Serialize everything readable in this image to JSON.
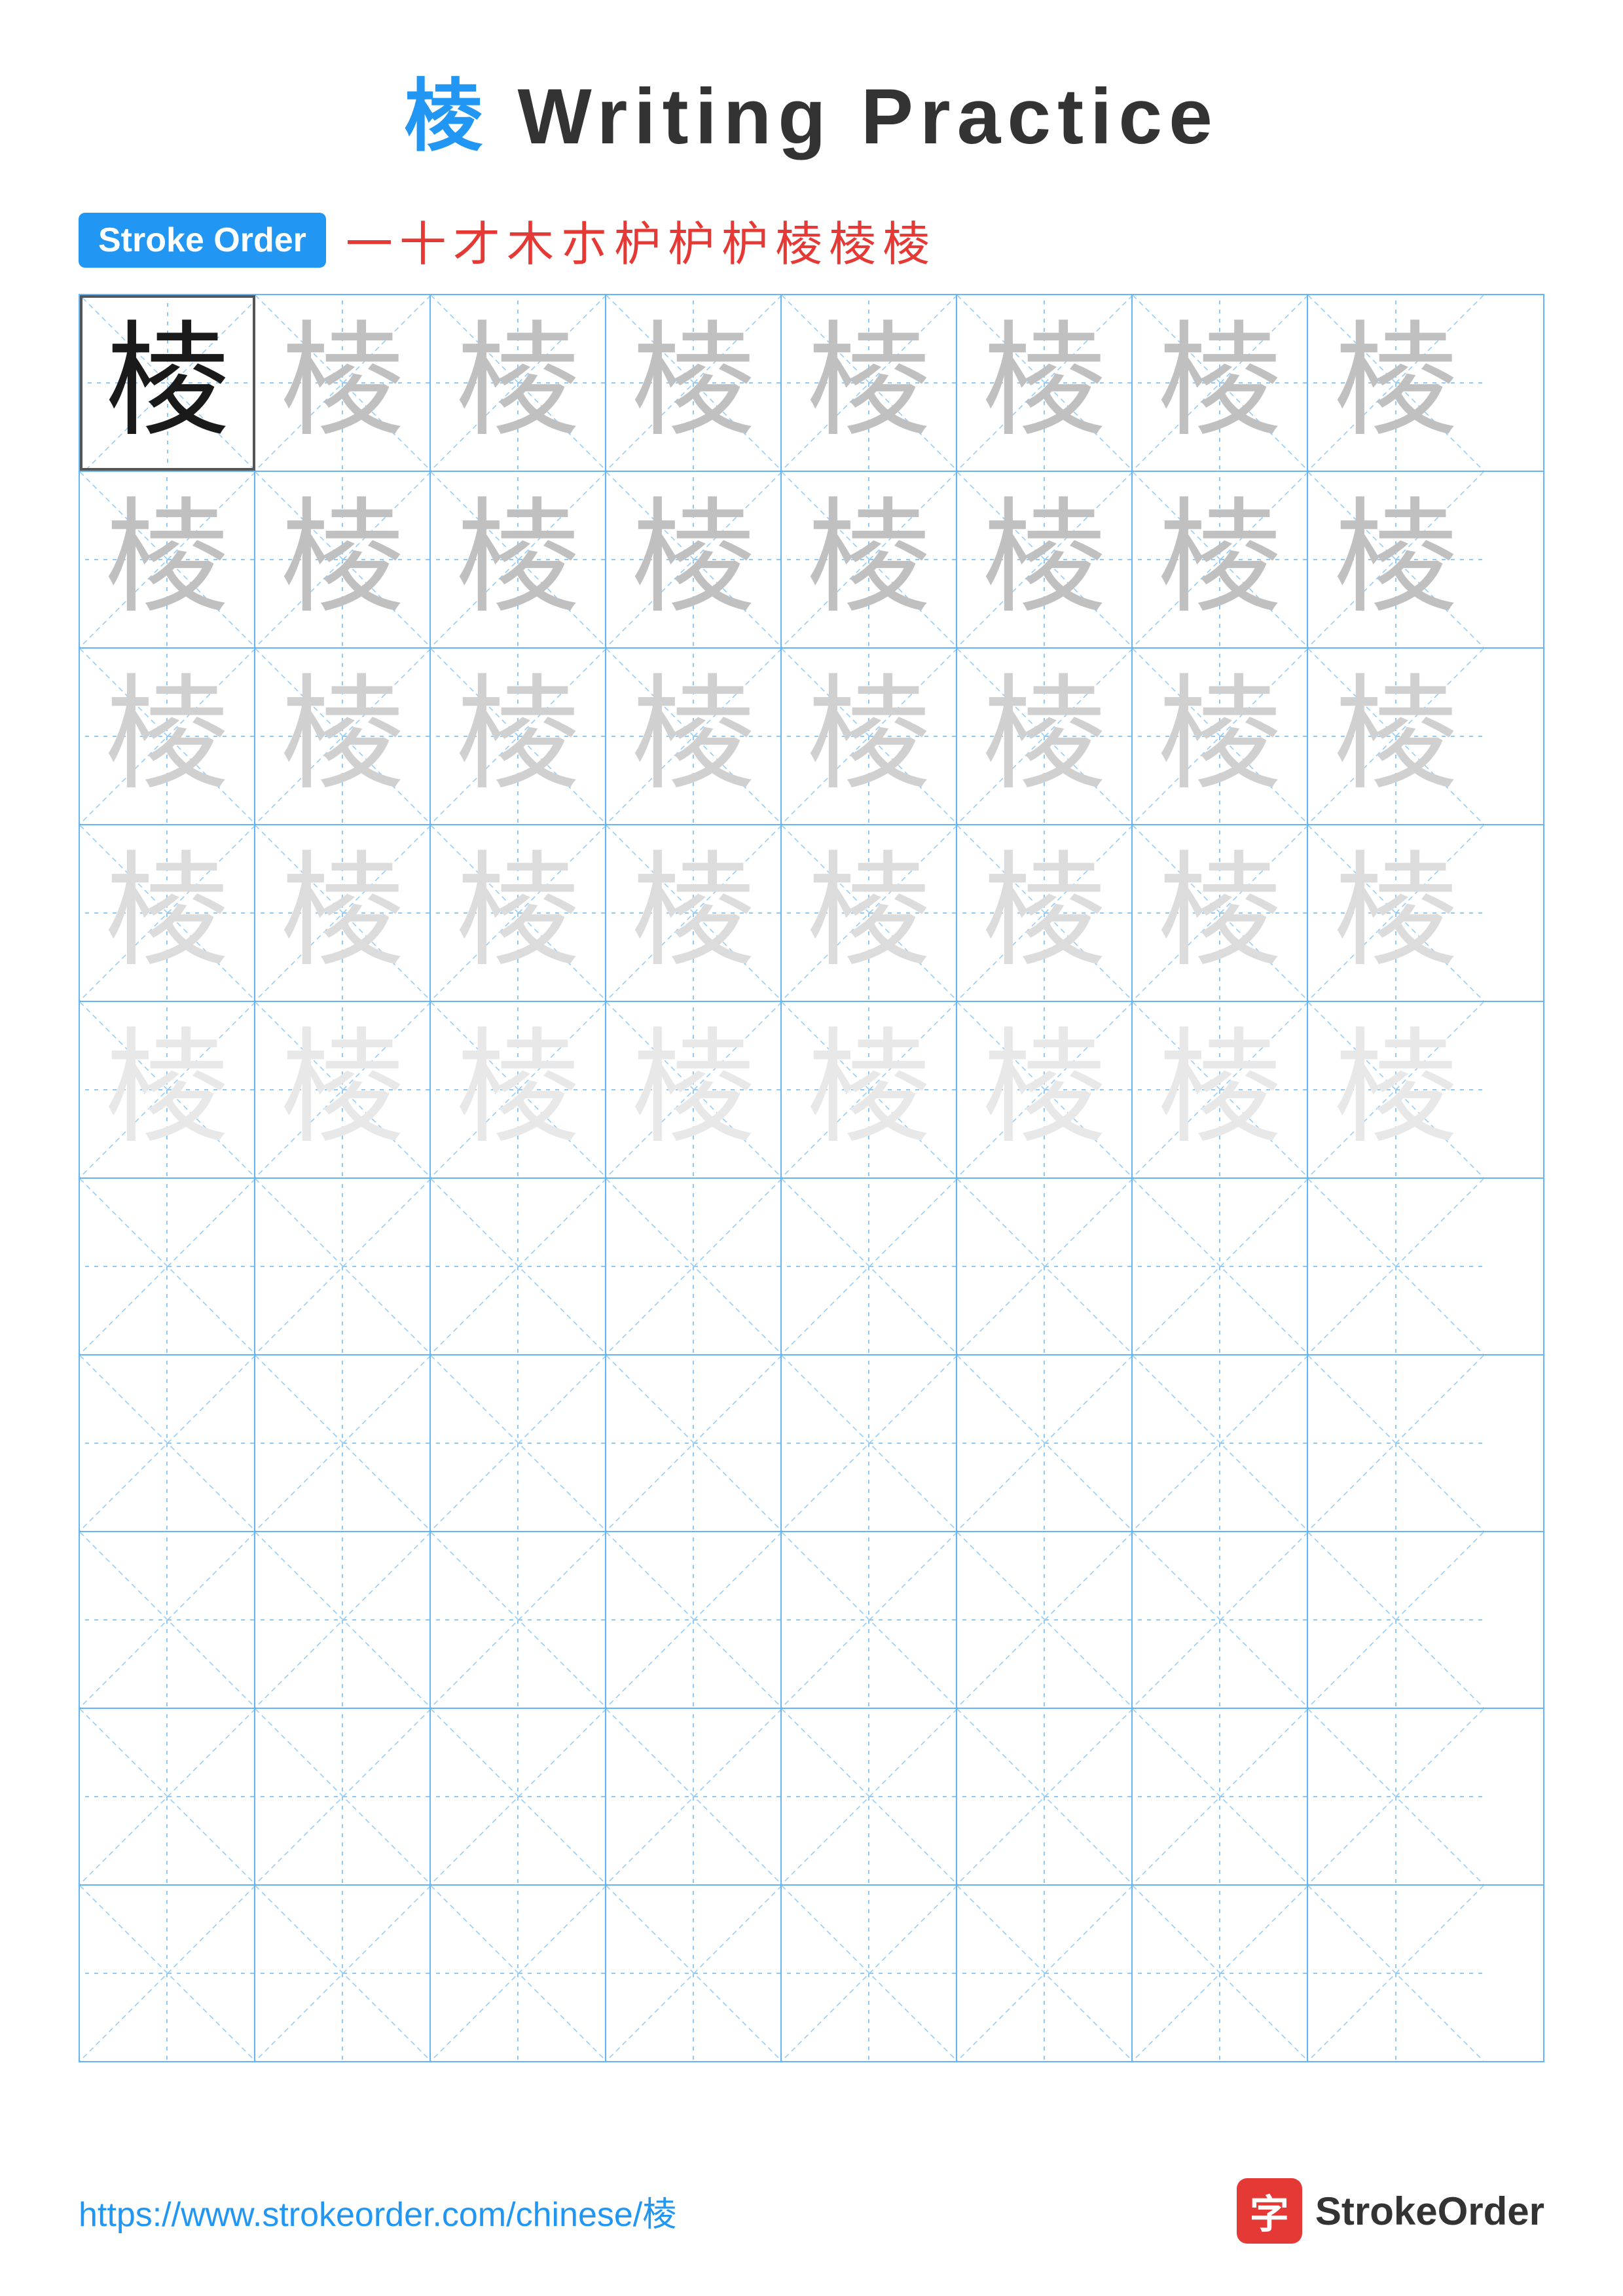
{
  "title": {
    "char": "棱",
    "text": " Writing Practice"
  },
  "strokeOrder": {
    "badge": "Stroke Order",
    "strokes": [
      "一",
      "十",
      "才",
      "木",
      "木",
      "枦",
      "枦",
      "枦",
      "棱",
      "棱",
      "棱"
    ]
  },
  "grid": {
    "rows": 10,
    "cols": 8,
    "char": "棱",
    "charRows": [
      [
        "dark",
        "light1",
        "light1",
        "light1",
        "light1",
        "light1",
        "light1",
        "light1"
      ],
      [
        "light1",
        "light1",
        "light1",
        "light1",
        "light1",
        "light1",
        "light1",
        "light1"
      ],
      [
        "light2",
        "light2",
        "light2",
        "light2",
        "light2",
        "light2",
        "light2",
        "light2"
      ],
      [
        "light3",
        "light3",
        "light3",
        "light3",
        "light3",
        "light3",
        "light3",
        "light3"
      ],
      [
        "light4",
        "light4",
        "light4",
        "light4",
        "light4",
        "light4",
        "light4",
        "light4"
      ],
      [
        "empty",
        "empty",
        "empty",
        "empty",
        "empty",
        "empty",
        "empty",
        "empty"
      ],
      [
        "empty",
        "empty",
        "empty",
        "empty",
        "empty",
        "empty",
        "empty",
        "empty"
      ],
      [
        "empty",
        "empty",
        "empty",
        "empty",
        "empty",
        "empty",
        "empty",
        "empty"
      ],
      [
        "empty",
        "empty",
        "empty",
        "empty",
        "empty",
        "empty",
        "empty",
        "empty"
      ],
      [
        "empty",
        "empty",
        "empty",
        "empty",
        "empty",
        "empty",
        "empty",
        "empty"
      ]
    ]
  },
  "footer": {
    "url": "https://www.strokeorder.com/chinese/棱",
    "logoChar": "字",
    "logoText": "StrokeOrder"
  }
}
